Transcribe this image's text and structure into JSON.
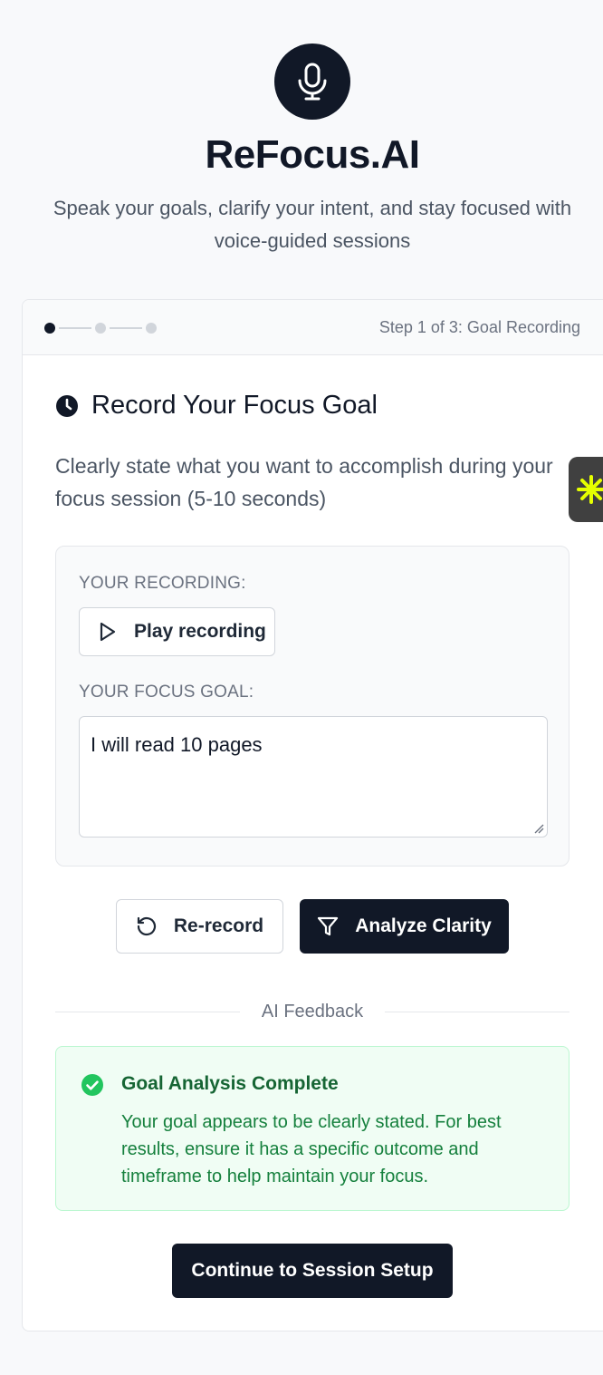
{
  "app": {
    "title": "ReFocus.AI",
    "subtitle": "Speak your goals, clarify your intent, and stay focused with voice-guided sessions",
    "logo_icon": "microphone-icon"
  },
  "stepper": {
    "steps": 3,
    "current": 1,
    "label": "Step 1 of 3: Goal Recording"
  },
  "section": {
    "icon": "clock-icon",
    "title": "Record Your Focus Goal",
    "description": "Clearly state what you want to accomplish during your focus session (5-10 seconds)"
  },
  "recording": {
    "recording_label": "YOUR RECORDING:",
    "play_label": "Play recording",
    "goal_label": "YOUR FOCUS GOAL:",
    "goal_value": "I will read 10 pages"
  },
  "actions": {
    "rerecord_label": "Re-record",
    "analyze_label": "Analyze Clarity"
  },
  "feedback": {
    "divider_label": "AI Feedback",
    "title": "Goal Analysis Complete",
    "body": "Your goal appears to be clearly stated. For best results, ensure it has a specific outcome and timeframe to help maintain your focus.",
    "status": "success"
  },
  "continue_label": "Continue to Session Setup",
  "colors": {
    "primary": "#111827",
    "success_bg": "#f0fdf4",
    "success_text": "#15803d",
    "success_icon": "#22c55e",
    "widget_bg": "#404040",
    "widget_accent": "#e5ff00"
  }
}
